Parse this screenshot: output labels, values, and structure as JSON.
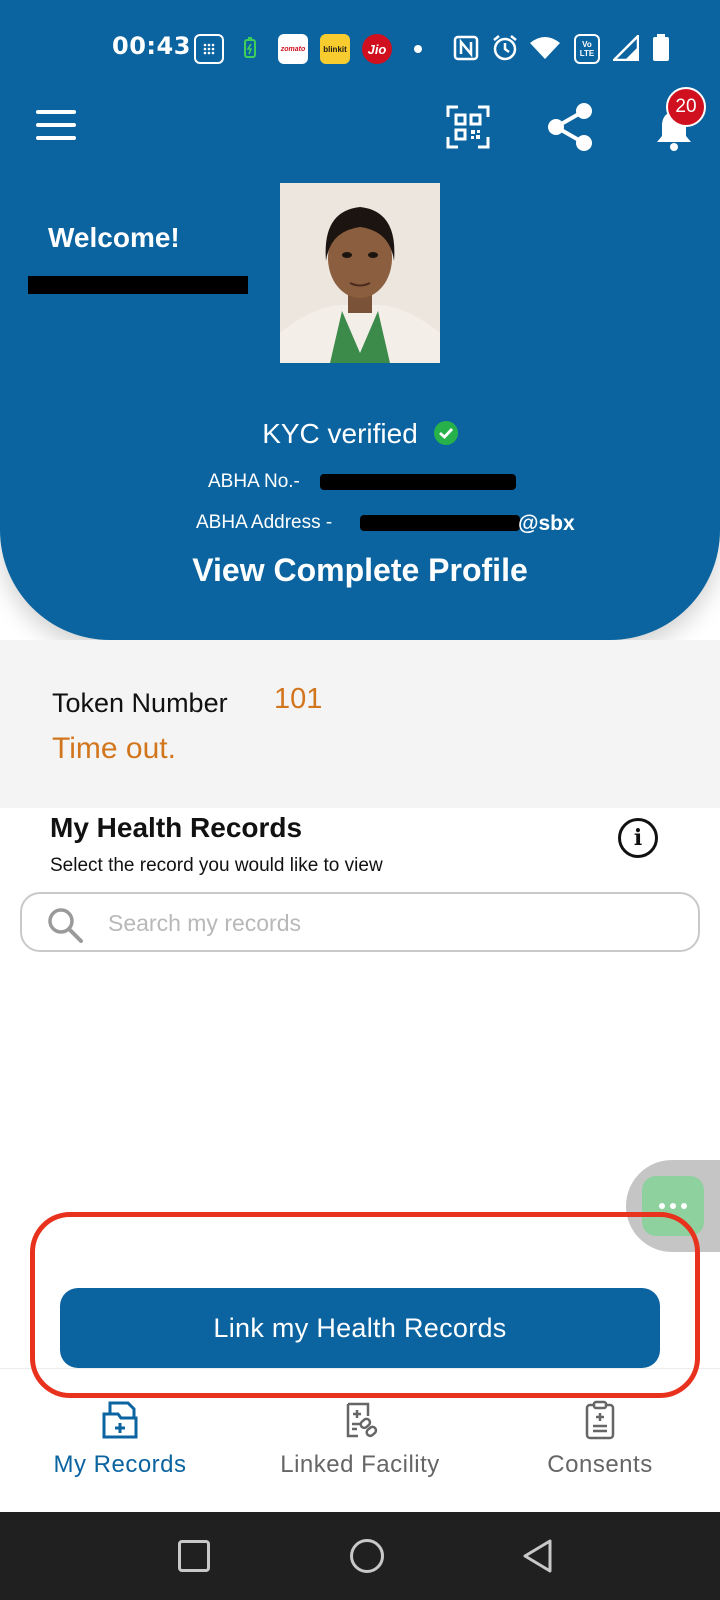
{
  "status_bar": {
    "time": "00:43",
    "app_badges": [
      "zomato",
      "blinkit",
      "Jio"
    ],
    "volte_label": "Vo LTE"
  },
  "header": {
    "notification_count": "20",
    "welcome": "Welcome!",
    "kyc_status": "KYC verified",
    "abha_number_label": "ABHA No.-",
    "abha_address_label": "ABHA Address -",
    "abha_address_suffix": "@sbx",
    "view_profile": "View Complete Profile"
  },
  "token": {
    "label": "Token Number",
    "number": "101",
    "status": "Time out."
  },
  "records": {
    "title": "My Health Records",
    "subtitle": "Select the record you would like to view",
    "search_placeholder": "Search my records",
    "link_button": "Link my Health Records"
  },
  "bottom_nav": {
    "items": [
      {
        "label": "My Records",
        "active": true
      },
      {
        "label": "Linked Facility",
        "active": false
      },
      {
        "label": "Consents",
        "active": false
      }
    ]
  },
  "colors": {
    "primary": "#0b64a0",
    "accent_orange": "#d2761e",
    "verified_green": "#27b14a",
    "highlight_red": "#e8321e",
    "notification_red": "#d0101e"
  }
}
